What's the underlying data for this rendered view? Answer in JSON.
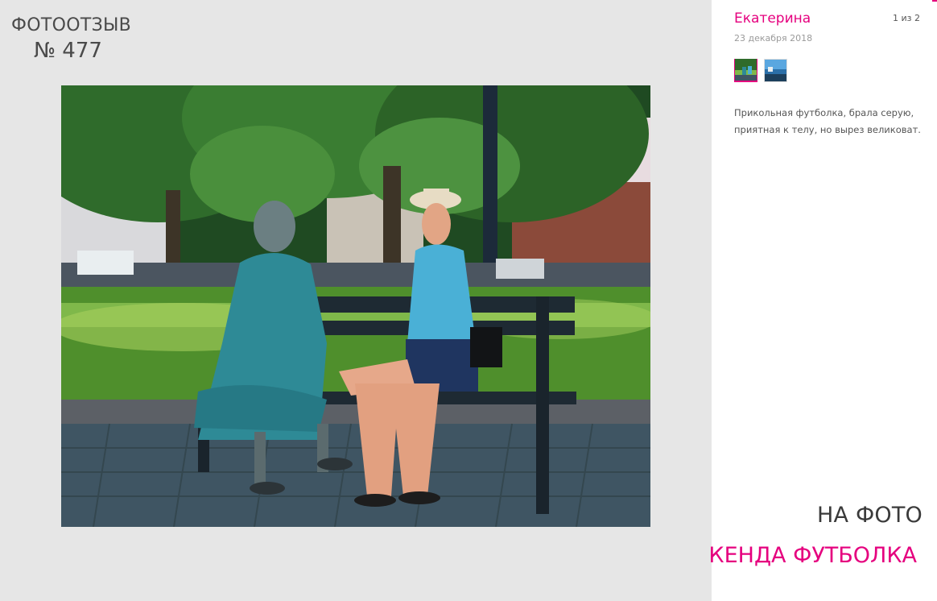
{
  "review": {
    "label": "ФОТООТЗЫВ",
    "number": "№ 477"
  },
  "photo": {
    "alt": "Фотоотзыв покупателя"
  },
  "sidebar": {
    "author": "Екатерина",
    "date": "23 декабря 2018",
    "counter": "1 из 2",
    "thumbnails": [
      {
        "index": 1,
        "selected": true
      },
      {
        "index": 2,
        "selected": false
      }
    ],
    "text": "Прикольная футболка, брала серую, приятная к телу, но вырез великоват.",
    "on_photo_label": "НА ФОТО",
    "product_link": "КЕНДА ФУТБОЛКА"
  },
  "colors": {
    "accent": "#e5007e",
    "background": "#e6e6e6",
    "panel": "#ffffff",
    "text_dark": "#4a4a4a",
    "text_muted": "#9a9a9a"
  },
  "icons": {}
}
